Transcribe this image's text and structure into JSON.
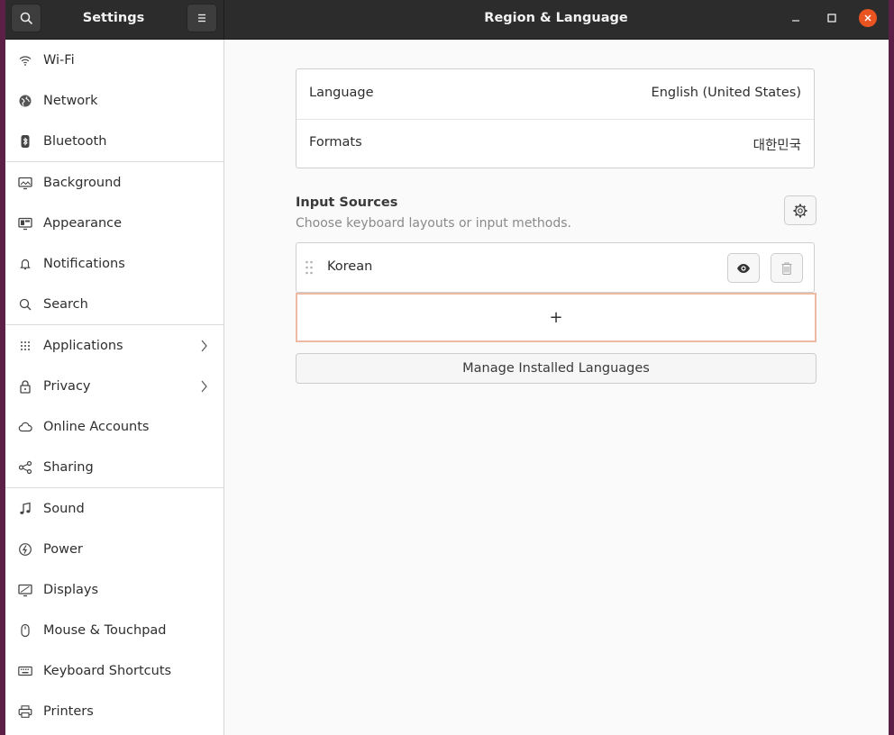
{
  "window": {
    "sidebar_title": "Settings",
    "page_title": "Region & Language"
  },
  "sidebar": {
    "items": [
      {
        "label": "Wi-Fi",
        "icon": "wifi-icon"
      },
      {
        "label": "Network",
        "icon": "network-icon"
      },
      {
        "label": "Bluetooth",
        "icon": "bluetooth-icon"
      },
      {
        "label": "Background",
        "icon": "background-icon"
      },
      {
        "label": "Appearance",
        "icon": "appearance-icon"
      },
      {
        "label": "Notifications",
        "icon": "bell-icon"
      },
      {
        "label": "Search",
        "icon": "search-icon"
      },
      {
        "label": "Applications",
        "icon": "apps-grid-icon"
      },
      {
        "label": "Privacy",
        "icon": "lock-icon"
      },
      {
        "label": "Online Accounts",
        "icon": "cloud-icon"
      },
      {
        "label": "Sharing",
        "icon": "share-icon"
      },
      {
        "label": "Sound",
        "icon": "music-note-icon"
      },
      {
        "label": "Power",
        "icon": "power-icon"
      },
      {
        "label": "Displays",
        "icon": "display-icon"
      },
      {
        "label": "Mouse & Touchpad",
        "icon": "mouse-icon"
      },
      {
        "label": "Keyboard Shortcuts",
        "icon": "keyboard-icon"
      },
      {
        "label": "Printers",
        "icon": "printer-icon"
      }
    ]
  },
  "main": {
    "language_label": "Language",
    "language_value": "English (United States)",
    "formats_label": "Formats",
    "formats_value": "대한민국",
    "input_sources_title": "Input Sources",
    "input_sources_subtitle": "Choose keyboard layouts or input methods.",
    "input_sources": [
      {
        "name": "Korean"
      }
    ],
    "add_symbol": "+",
    "manage_button": "Manage Installed Languages"
  },
  "colors": {
    "accent": "#e95420",
    "focus_border": "#f0b9a3",
    "headerbar": "#2c2c2c"
  }
}
